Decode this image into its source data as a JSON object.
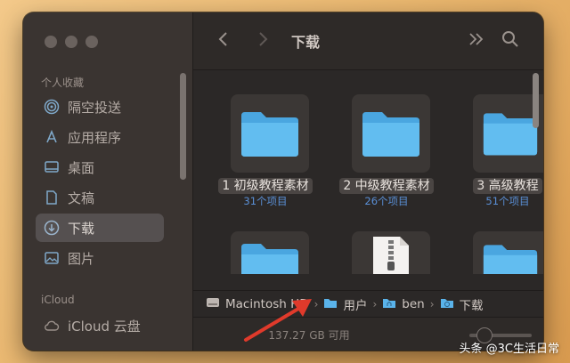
{
  "window": {
    "title": "下载"
  },
  "sidebar": {
    "favorites_title": "个人收藏",
    "items": [
      {
        "label": "隔空投送",
        "icon": "airdrop-icon"
      },
      {
        "label": "应用程序",
        "icon": "applications-icon"
      },
      {
        "label": "桌面",
        "icon": "desktop-icon"
      },
      {
        "label": "文稿",
        "icon": "documents-icon"
      },
      {
        "label": "下载",
        "icon": "download-icon",
        "active": true
      },
      {
        "label": "图片",
        "icon": "pictures-icon"
      }
    ],
    "icloud_title": "iCloud",
    "icloud_items": [
      {
        "label": "iCloud 云盘",
        "icon": "cloud-icon"
      }
    ]
  },
  "toolbar": {
    "back_icon": "chevron-left-icon",
    "forward_icon": "chevron-right-icon",
    "more_icon": "double-chevron-icon",
    "search_icon": "search-icon"
  },
  "files": [
    {
      "name": "1 初级教程素材",
      "count": "31个项目",
      "type": "folder"
    },
    {
      "name": "2 中级教程素材",
      "count": "26个项目",
      "type": "folder"
    },
    {
      "name": "3 高级教程",
      "count": "51个项目",
      "type": "folder"
    },
    {
      "name": "",
      "count": "",
      "type": "folder"
    },
    {
      "name": "",
      "count": "",
      "type": "zip"
    },
    {
      "name": "",
      "count": "",
      "type": "folder"
    }
  ],
  "pathbar": {
    "crumbs": [
      "Macintosh HD",
      "用户",
      "ben",
      "下载"
    ]
  },
  "statusbar": {
    "free_space": "137.27 GB 可用"
  },
  "watermark": "头条 @3C生活日常",
  "colors": {
    "folder": "#5ab3ea",
    "accent": "#5a8fd6",
    "arrow": "#e03a2b"
  }
}
